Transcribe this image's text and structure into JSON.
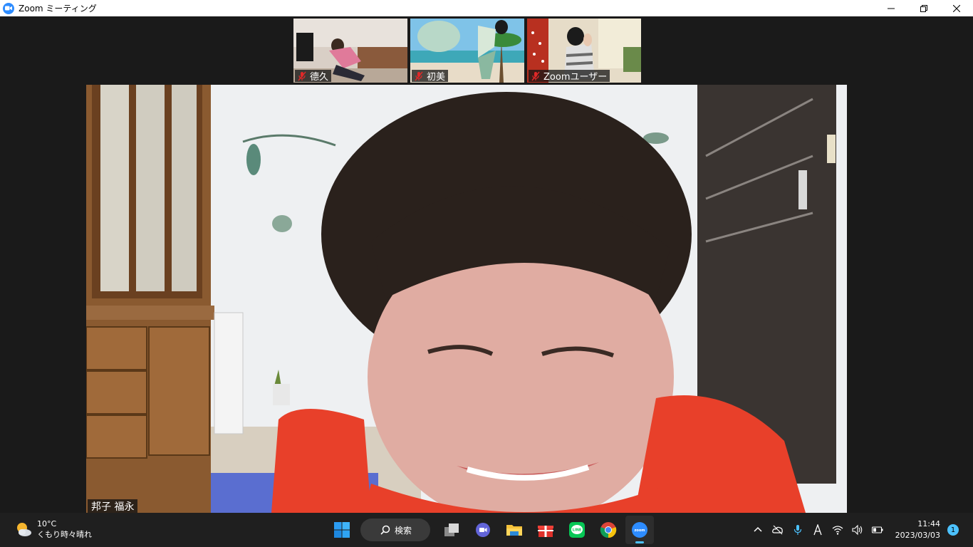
{
  "window": {
    "title": "Zoom ミーティング",
    "accent": "#2d8cff"
  },
  "participants": [
    {
      "name": "德久",
      "muted": true
    },
    {
      "name": "初美",
      "muted": true
    },
    {
      "name": "Zoomユーザー",
      "muted": true
    }
  ],
  "active_speaker": {
    "name": "邦子 福永"
  },
  "taskbar": {
    "weather": {
      "temp": "10°C",
      "condition": "くもり時々晴れ"
    },
    "search_label": "検索",
    "apps": [
      "start-icon",
      "task-view-icon",
      "teams-chat-icon",
      "file-explorer-icon",
      "gift-icon",
      "line-icon",
      "chrome-icon",
      "zoom-icon"
    ],
    "active_app": "zoom-icon",
    "clock": {
      "time": "11:44",
      "date": "2023/03/03"
    },
    "notification_count": "1"
  }
}
